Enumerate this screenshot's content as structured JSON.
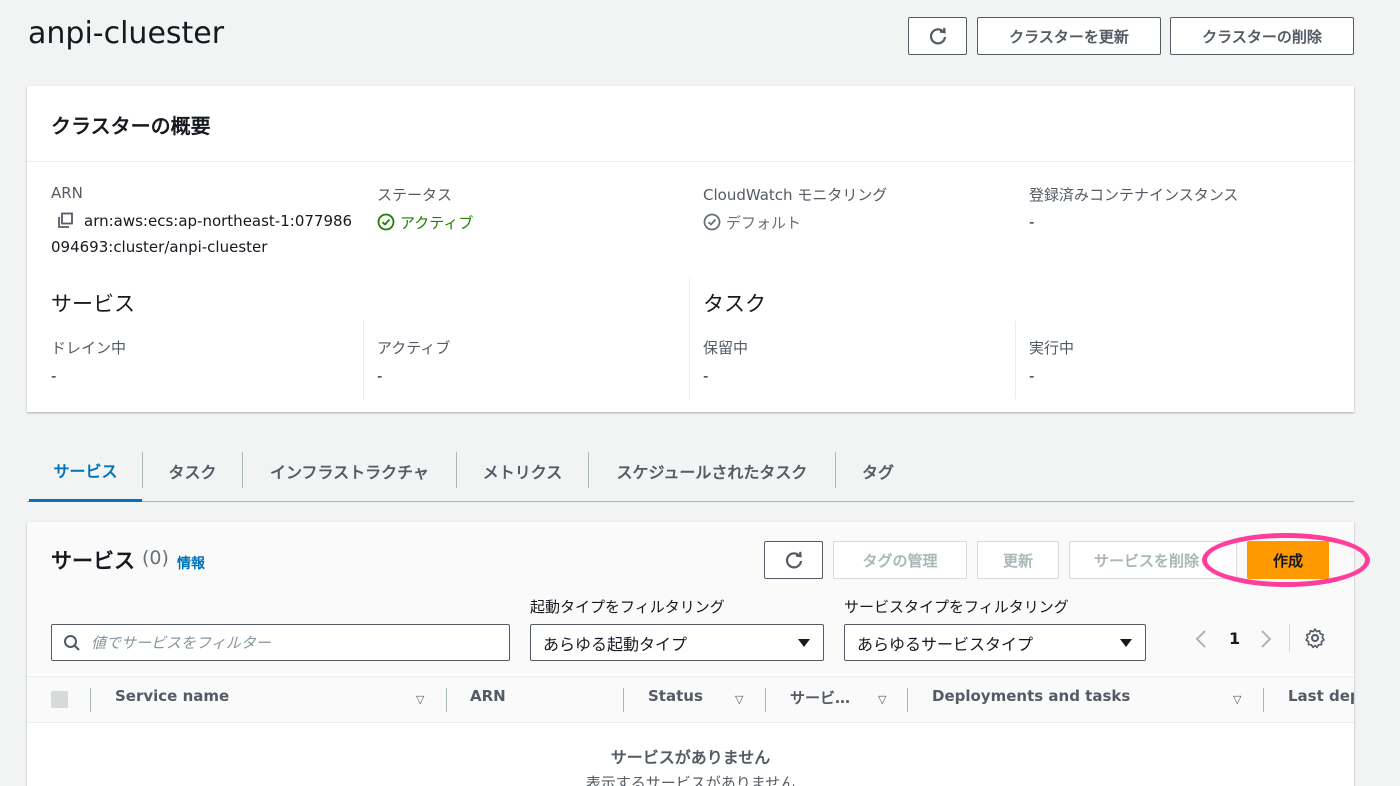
{
  "page": {
    "title": "anpi-cluester"
  },
  "header_buttons": {
    "update": "クラスターを更新",
    "delete": "クラスターの削除"
  },
  "overview": {
    "title": "クラスターの概要",
    "arn_label": "ARN",
    "arn_line1": "arn:aws:ecs:ap-northeast-1:077986",
    "arn_line2": "094693:cluster/anpi-cluester",
    "status_label": "ステータス",
    "status_value": "アクティブ",
    "cloudwatch_label": "CloudWatch モニタリング",
    "cloudwatch_value": "デフォルト",
    "instances_label": "登録済みコンテナインスタンス",
    "instances_value": "-",
    "services_title": "サービス",
    "draining_label": "ドレイン中",
    "draining_value": "-",
    "active_label": "アクティブ",
    "active_value": "-",
    "tasks_title": "タスク",
    "pending_label": "保留中",
    "pending_value": "-",
    "running_label": "実行中",
    "running_value": "-"
  },
  "tabs": [
    "サービス",
    "タスク",
    "インフラストラクチャ",
    "メトリクス",
    "スケジュールされたタスク",
    "タグ"
  ],
  "services": {
    "title": "サービス",
    "count": "(0)",
    "info": "情報",
    "btn_manage_tags": "タグの管理",
    "btn_update": "更新",
    "btn_delete": "サービスを削除",
    "btn_create": "作成",
    "search_placeholder": "値でサービスをフィルター",
    "launch_filter_label": "起動タイプをフィルタリング",
    "launch_filter_value": "あらゆる起動タイプ",
    "type_filter_label": "サービスタイプをフィルタリング",
    "type_filter_value": "あらゆるサービスタイプ",
    "page_number": "1",
    "columns": [
      "Service name",
      "ARN",
      "Status",
      "サービ…",
      "Deployments and tasks",
      "Last dep"
    ],
    "empty_title": "サービスがありません",
    "empty_subtitle": "表示するサービスがありません"
  },
  "colors": {
    "accent": "#0073bb",
    "primary": "#ff9900",
    "status_green": "#1d8102",
    "highlight": "#ff3d9a"
  }
}
